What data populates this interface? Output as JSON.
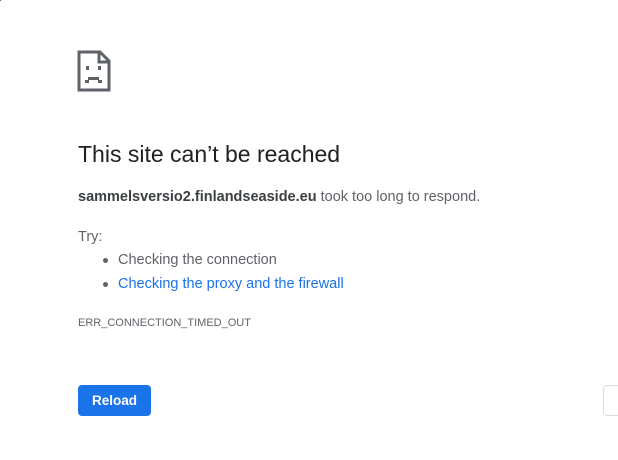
{
  "error_page": {
    "icon": "sad-page-icon",
    "title": "This site can’t be reached",
    "host": "sammelsversio2.finlandseaside.eu",
    "message_suffix": " took too long to respond.",
    "try_label": "Try:",
    "suggestions": [
      {
        "label": "Checking the connection",
        "is_link": false
      },
      {
        "label": "Checking the proxy and the firewall",
        "is_link": true
      }
    ],
    "error_code": "ERR_CONNECTION_TIMED_OUT",
    "reload_label": "Reload",
    "details_label": ""
  },
  "colors": {
    "accent": "#1a73e8",
    "text_primary": "#202124",
    "text_secondary": "#5f6368",
    "border": "#dadce0",
    "background": "#ffffff"
  }
}
